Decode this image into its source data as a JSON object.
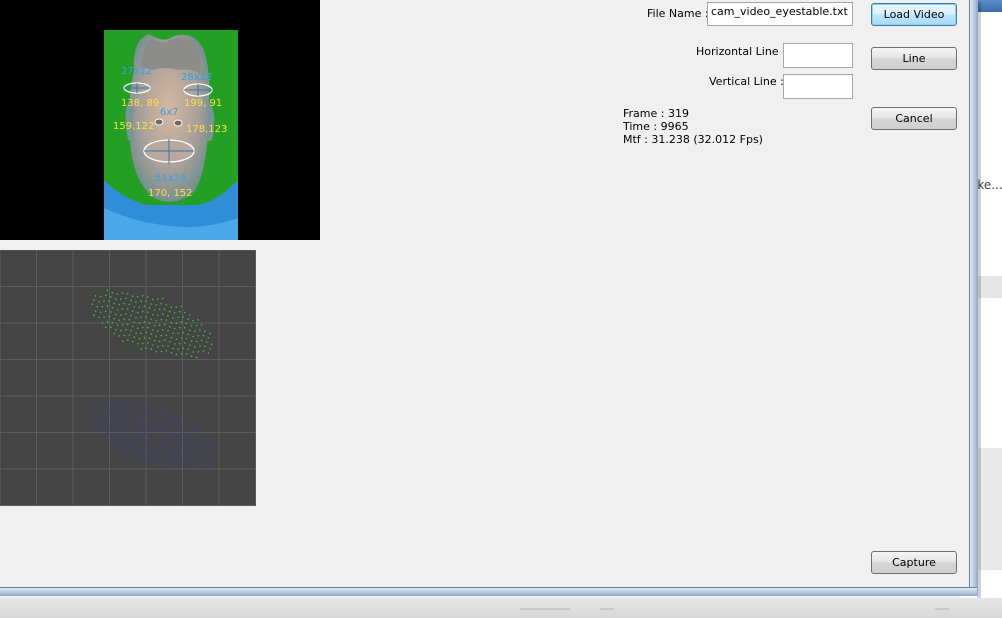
{
  "background_window": {
    "text": "ike..."
  },
  "video": {
    "labels": {
      "left_eye_size": "27x12",
      "right_eye_size": "28x12",
      "left_eye_pos": "138, 89",
      "right_eye_pos": "199, 91",
      "nose_size": "6x7",
      "left_nostril_pos": "159,122",
      "right_nostril_pos": "178,123",
      "mouth_size": "51x24",
      "mouth_pos": "170, 152"
    }
  },
  "form": {
    "file_name_label": "File Name :",
    "file_name_value": "cam_video_eyestable.txt",
    "horizontal_line_label": "Horizontal Line :",
    "horizontal_line_value": "",
    "vertical_line_label": "Vertical Line :",
    "vertical_line_value": ""
  },
  "info": {
    "frame": "Frame : 319",
    "time": "Time : 9965",
    "mtf": "Mtf : 31.238 (32.012 Fps)"
  },
  "buttons": {
    "load_video": "Load Video",
    "line": "Line",
    "cancel": "Cancel",
    "capture": "Capture"
  },
  "colors": {
    "green_cloud": "#3fc43f",
    "blue_cloud": "#3a3ac0",
    "label_yellow": "#ffe040",
    "label_blue": "#3aa0e0"
  }
}
